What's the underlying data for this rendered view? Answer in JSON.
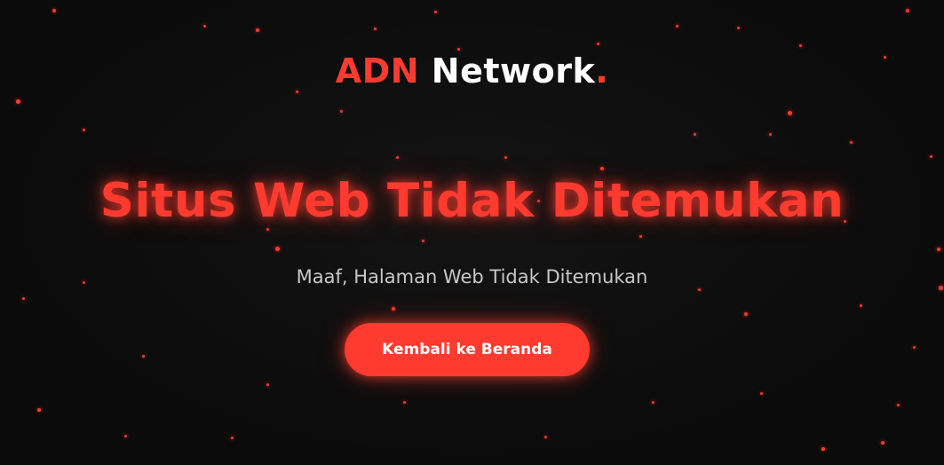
{
  "brand": {
    "accent": "ADN",
    "main": "Network",
    "dot": ".",
    "accent_color": "#ff3b2f"
  },
  "headline": "Situs Web Tidak Ditemukan",
  "subtitle": "Maaf, Halaman Web Tidak Ditemukan",
  "cta": {
    "label": "Kembali ke Beranda"
  }
}
